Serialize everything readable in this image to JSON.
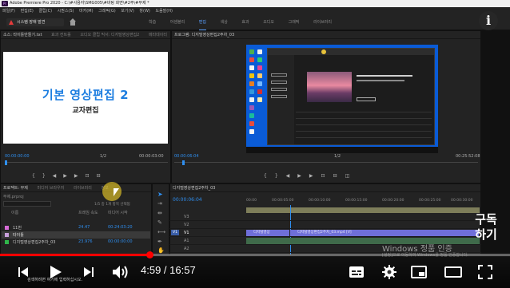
{
  "window": {
    "title": "Adobe Premiere Pro 2020 - C:\\#사용자\\SMG005\\#바탕 화면\\#2주\\#부제 *"
  },
  "menu": [
    "파일(F)",
    "편집(E)",
    "클립(C)",
    "시퀀스(S)",
    "마커(M)",
    "그래픽(G)",
    "보기(V)",
    "창(W)",
    "도움말(H)"
  ],
  "workspace": {
    "alert_button": "시스템 장애 발견",
    "tabs": [
      "학습",
      "어셈블리",
      "편집",
      "색상",
      "효과",
      "오디오",
      "그래픽",
      "라이브러리"
    ],
    "active_tab": "편집"
  },
  "source_panel": {
    "tabs": [
      "소스: 타이틀만들기.txt",
      "효과 컨트롤",
      "오디오 클립 믹서: 디지털영상편집2",
      "메타데이터"
    ],
    "title_line1": "기본 영상편집 2",
    "title_line2": "교자편집",
    "timecode_left": "00:00:00:00",
    "fit": "1/2",
    "timecode_right": "00:00:03:00"
  },
  "program_panel": {
    "tab": "프로그램: 디지털영상편집2주차_03",
    "timecode_left": "00:00:06:04",
    "fit": "1/2",
    "timecode_right": "00:25:52:08"
  },
  "project_panel": {
    "tabs": [
      "프로젝트: 부제",
      "미디어 브라우저",
      "라이브러리",
      "정보"
    ],
    "file": "부제.prproj",
    "selection_info": "1/5 중 1개 항목 선택됨",
    "columns": [
      "이름",
      "프레임 속도",
      "미디어 시작"
    ],
    "items": [
      {
        "name": "11번",
        "fps": "24.47",
        "start": "00:24:03:20",
        "color": "#d66bd6"
      },
      {
        "name": "타이틀",
        "fps": "",
        "start": "",
        "color": "#c9a0dc"
      },
      {
        "name": "디지털영상편집2주차_03",
        "fps": "23.976",
        "start": "00:00:00:00",
        "color": "#2fb64a"
      }
    ]
  },
  "timeline": {
    "tab": "디지털영상편집2주차_03",
    "timecode": "00:00:06:04",
    "ruler": [
      "00:00",
      "00:00:05:00",
      "00:00:10:00",
      "00:00:15:00",
      "00:00:20:00",
      "00:00:25:00",
      "00:00:30:00"
    ],
    "tracks": [
      "V3",
      "V2",
      "V1",
      "A1",
      "A2",
      "A3"
    ],
    "clips": [
      {
        "track": "V1",
        "label": "디지털영상",
        "color": "#6f6fd8"
      },
      {
        "track": "V1",
        "label": "디지털영상편집2주차_03.mp4 [V]",
        "color": "#6f6fd8"
      }
    ]
  },
  "windows_overlay": {
    "activate": "Windows 정품 인증",
    "activate_sub": "[설정]으로 이동하여 Windows를 정품 인증합니다.",
    "search": "검색하려면 여기에 입력하십시오."
  },
  "youtube": {
    "current_time": "4:59",
    "duration": "16:57",
    "time_display": "4:59 / 16:57",
    "progress": 0.294,
    "subscribe_text": "구독\n하기",
    "info_icon": "i"
  },
  "colors": {
    "accent_blue": "#2f8ff0",
    "yt_red": "#ff0000",
    "title_blue": "#1d7ee0"
  }
}
